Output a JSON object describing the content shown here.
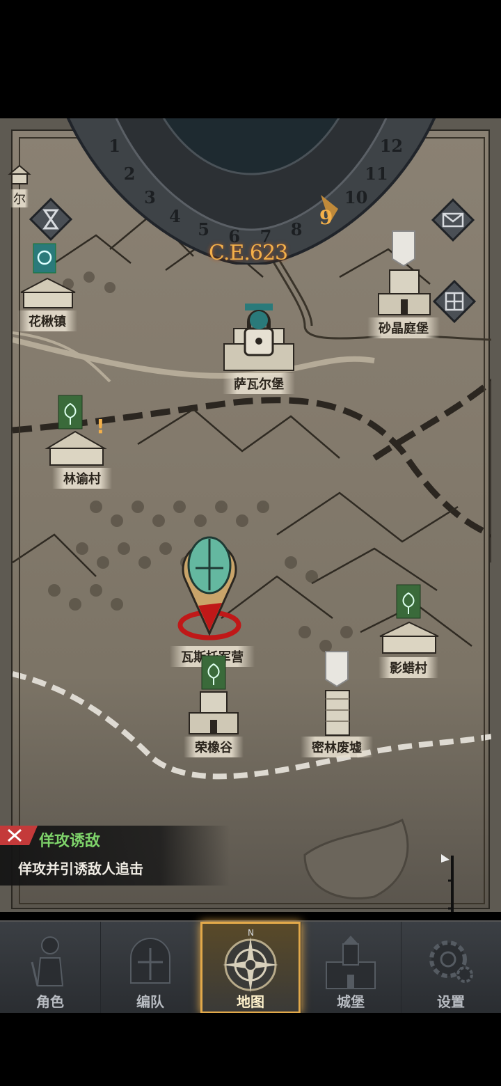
{
  "calendar": {
    "year": "C.E.623",
    "months": [
      "1",
      "2",
      "3",
      "4",
      "5",
      "6",
      "7",
      "8",
      "9",
      "10",
      "11",
      "12"
    ],
    "current_month": "9"
  },
  "side_buttons": {
    "hourglass": "hourglass-icon",
    "mail": "envelope-icon",
    "map_grid": "grid-icon"
  },
  "locations": {
    "huajiao": "花楸镇",
    "shajing": "砂晶庭堡",
    "sawaer": "萨瓦尔堡",
    "linyu": "林谕村",
    "wasi": "瓦斯托军营",
    "yingla": "影蜡村",
    "rongxiang": "荣橡谷",
    "milin": "密林废墟",
    "edge_partial": "尔"
  },
  "toast": {
    "title": "佯攻诱敌",
    "description": "佯攻并引诱敌人追击"
  },
  "nav": {
    "items": [
      {
        "label": "角色",
        "icon": "knight-icon"
      },
      {
        "label": "编队",
        "icon": "helmet-icon"
      },
      {
        "label": "地图",
        "icon": "compass-icon"
      },
      {
        "label": "城堡",
        "icon": "castle-icon"
      },
      {
        "label": "设置",
        "icon": "gear-icon"
      }
    ],
    "active_index": 2,
    "compass_n": "N"
  },
  "colors": {
    "accent": "#e2a94a",
    "year": "#f3b04a",
    "toast_title": "#7ed36a",
    "banner_green": "#3a6a3a"
  }
}
